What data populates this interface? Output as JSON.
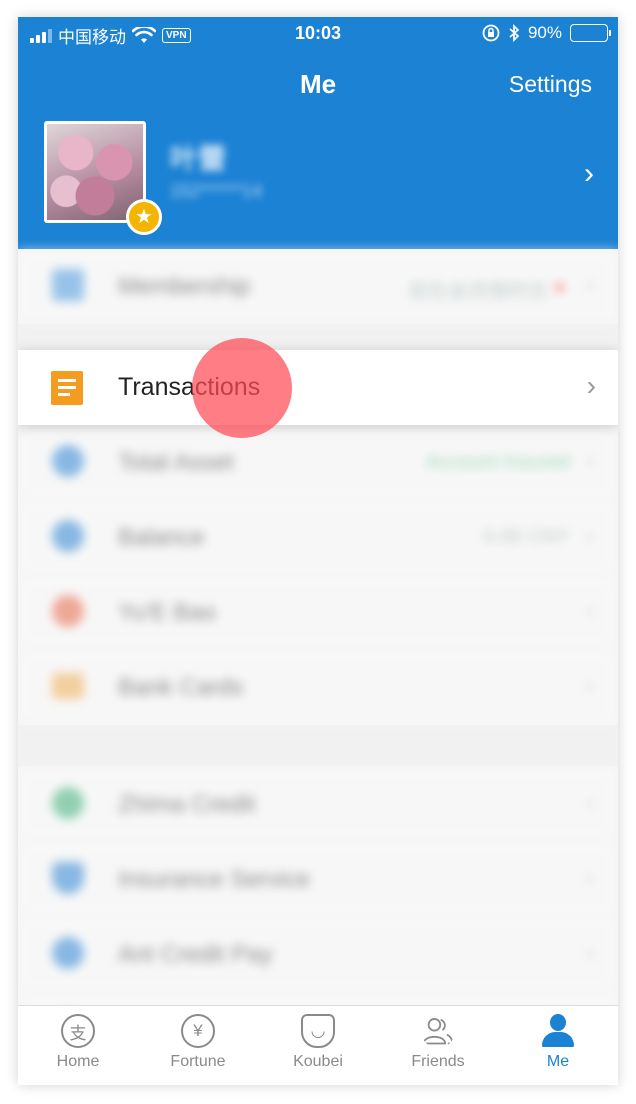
{
  "status_bar": {
    "carrier": "中国移动",
    "vpn": "VPN",
    "time": "10:03",
    "battery": "90%",
    "battery_level": 0.9
  },
  "nav": {
    "title": "Me",
    "settings": "Settings"
  },
  "profile": {
    "name": "叶蕾",
    "phone": "152******14"
  },
  "rows": {
    "membership": {
      "label": "Membership",
      "value": "现在会员限时兑"
    },
    "transactions": {
      "label": "Transactions"
    },
    "total_asset": {
      "label": "Total Asset",
      "value": "Account Insured"
    },
    "balance": {
      "label": "Balance",
      "value": "0.00 CNY"
    },
    "yue_bao": {
      "label": "Yu'E Bao"
    },
    "bank_cards": {
      "label": "Bank Cards"
    },
    "zhima_credit": {
      "label": "Zhima Credit"
    },
    "insurance": {
      "label": "Insurance Service"
    },
    "ant_credit_pay": {
      "label": "Ant Credit Pay"
    }
  },
  "tabs": [
    {
      "label": "Home",
      "glyph": "支"
    },
    {
      "label": "Fortune",
      "glyph": "¥"
    },
    {
      "label": "Koubei",
      "glyph": "◡"
    },
    {
      "label": "Friends",
      "glyph": ""
    },
    {
      "label": "Me",
      "glyph": ""
    }
  ],
  "colors": {
    "brand": "#1c82d4",
    "transactions_icon": "#f39c1f",
    "tap_indicator": "#ff4b55"
  }
}
